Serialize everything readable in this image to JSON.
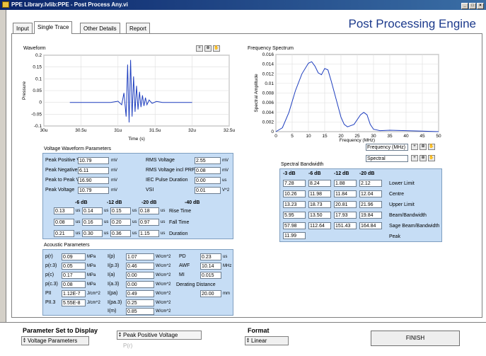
{
  "window": {
    "title": "PPE Library.lvlib:PPE - Post Process Any.vi"
  },
  "app_title": "Post Processing Engine",
  "tabs": [
    "Input",
    "Single Trace",
    "Other Details",
    "Report"
  ],
  "waveform": {
    "title": "Waveform",
    "ylabel": "Pressure",
    "xlabel": "Time (s)",
    "x_ticks": [
      "30u",
      "30.5u",
      "31u",
      "31.5u",
      "32u",
      "32.5u"
    ],
    "y_ticks": [
      "0.2",
      "0.15",
      "0.1",
      "0.05",
      "0",
      "-0.05",
      "-0.1"
    ]
  },
  "spectrum": {
    "title": "Frequency Spectrum",
    "ylabel": "Spectral Amplitude",
    "xlabel": "Frequency (MHz)",
    "x_ticks": [
      "0",
      "5",
      "10",
      "15",
      "20",
      "25",
      "30",
      "35",
      "40",
      "45",
      "50"
    ],
    "y_ticks": [
      "0.016",
      "0.014",
      "0.012",
      "0.01",
      "0.008",
      "0.006",
      "0.004",
      "0.002",
      "0"
    ],
    "freq_unit": "Frequency (MHz)",
    "spectral_select": "Spectral"
  },
  "chart_data": [
    {
      "type": "line",
      "title": "Waveform",
      "xlabel": "Time (s)",
      "ylabel": "Pressure",
      "xlim": [
        30,
        32.5
      ],
      "ylim": [
        -0.1,
        0.2
      ],
      "x": [
        30.35,
        30.7,
        30.9,
        31.0,
        31.05,
        31.08,
        31.11,
        31.13,
        31.15,
        31.17,
        31.19,
        31.21,
        31.23,
        31.25,
        31.27,
        31.29,
        31.31,
        31.33,
        31.35,
        31.37,
        31.39,
        31.42,
        31.46,
        31.52,
        31.6,
        31.7,
        32.0
      ],
      "y": [
        0,
        0,
        0,
        0.005,
        -0.01,
        0.04,
        -0.06,
        0.16,
        -0.085,
        0.18,
        -0.06,
        0.11,
        -0.04,
        0.07,
        -0.03,
        0.045,
        -0.02,
        0.03,
        -0.015,
        0.02,
        -0.01,
        0.01,
        -0.004,
        0.004,
        0,
        0,
        0
      ]
    },
    {
      "type": "line",
      "title": "Frequency Spectrum",
      "xlabel": "Frequency (MHz)",
      "ylabel": "Spectral Amplitude",
      "xlim": [
        0,
        50
      ],
      "ylim": [
        0,
        0.016
      ],
      "x": [
        0,
        2,
        4,
        6,
        8,
        10,
        11,
        12,
        13,
        14,
        15,
        16,
        17,
        18,
        19,
        20,
        21,
        22,
        24,
        26,
        27,
        28,
        29,
        30,
        32,
        35,
        40,
        45,
        50
      ],
      "y": [
        0.0,
        0.0008,
        0.004,
        0.0085,
        0.012,
        0.0142,
        0.0145,
        0.0136,
        0.0122,
        0.0118,
        0.0131,
        0.0128,
        0.0105,
        0.008,
        0.0055,
        0.003,
        0.0015,
        0.001,
        0.0015,
        0.0035,
        0.004,
        0.0035,
        0.0015,
        0.0005,
        0.0002,
        0.0003,
        0.0002,
        0.0001,
        0.0
      ]
    }
  ],
  "voltage": {
    "title": "Voltage Waveform Parameters",
    "rows": [
      {
        "label": "Peak Positive Voltage",
        "value": "10.79",
        "unit": "mV",
        "label2": "RMS Voltage",
        "value2": "2.55",
        "unit2": "mV"
      },
      {
        "label": "Peak Negative Voltage",
        "value": "6.11",
        "unit": "mV",
        "label2": "RMS Voltage incl PRF",
        "value2": "0.08",
        "unit2": "mV"
      },
      {
        "label": "Peak to Peak Voltage",
        "value": "16.90",
        "unit": "mV",
        "label2": "IEC Pulse Duration",
        "value2": "0.00",
        "unit2": "us"
      },
      {
        "label": "Peak Voltage",
        "value": "10.79",
        "unit": "mV",
        "label2": "VSI",
        "value2": "0.01",
        "unit2": "V^2"
      }
    ],
    "db_headers": [
      "-6 dB",
      "-12 dB",
      "-20 dB",
      "-40 dB"
    ],
    "time_rows": [
      {
        "values": [
          "0.13",
          "0.14",
          "0.15",
          "0.18"
        ],
        "unit": "us",
        "label": "Rise Time"
      },
      {
        "values": [
          "0.08",
          "0.16",
          "0.20",
          "0.97"
        ],
        "unit": "us",
        "label": "Fall Time"
      },
      {
        "values": [
          "0.21",
          "0.30",
          "0.36",
          "1.15"
        ],
        "unit": "us",
        "label": "Duration"
      }
    ]
  },
  "acoustic": {
    "title": "Acoustic Parameters",
    "col1": [
      {
        "label": "p(r)",
        "value": "0.09",
        "unit": "MPa"
      },
      {
        "label": "p(r.3)",
        "value": "0.05",
        "unit": "MPa"
      },
      {
        "label": "p(c)",
        "value": "0.17",
        "unit": "MPa"
      },
      {
        "label": "p(c.3)",
        "value": "0.08",
        "unit": "MPa"
      },
      {
        "label": "PII",
        "value": "1.12E-7",
        "unit": "J/cm^2"
      },
      {
        "label": "PII.3",
        "value": "5.55E-8",
        "unit": "J/cm^2"
      }
    ],
    "col2": [
      {
        "label": "I(p)",
        "value": "1.07",
        "unit": "W/cm^2"
      },
      {
        "label": "I(p.3)",
        "value": "0.46",
        "unit": "W/cm^2"
      },
      {
        "label": "I(a)",
        "value": "0.00",
        "unit": "W/cm^2"
      },
      {
        "label": "I(a.3)",
        "value": "0.00",
        "unit": "W/cm^2"
      },
      {
        "label": "I(pa)",
        "value": "0.49",
        "unit": "W/cm^2"
      },
      {
        "label": "I(pa.3)",
        "value": "0.25",
        "unit": "W/cm^2"
      },
      {
        "label": "I(m)",
        "value": "0.85",
        "unit": "W/cm^2"
      }
    ],
    "col3": [
      {
        "label": "PD",
        "value": "0.23",
        "unit": "us"
      },
      {
        "label": "AWF",
        "value": "10.14",
        "unit": "MHz"
      },
      {
        "label": "MI",
        "value": "0.015",
        "unit": ""
      }
    ],
    "derating_label": "Derating Distance",
    "derating_value": "20.00",
    "derating_unit": "mm"
  },
  "bandwidth": {
    "title": "Spectral Bandwidth",
    "headers": [
      "-3 dB",
      "-6 dB",
      "-12 dB",
      "-20 dB"
    ],
    "rows": [
      {
        "values": [
          "7.28",
          "8.24",
          "1.88",
          "2.12"
        ],
        "label": "Lower Limit"
      },
      {
        "values": [
          "10.26",
          "11.98",
          "11.84",
          "12.04"
        ],
        "label": "Centre"
      },
      {
        "values": [
          "13.23",
          "18.73",
          "20.81",
          "21.96"
        ],
        "label": "Upper Limit"
      },
      {
        "values": [
          "5.95",
          "13.50",
          "17.93",
          "19.84"
        ],
        "label": "Beam/Bandwidth"
      },
      {
        "values": [
          "57.98",
          "112.64",
          "151.43",
          "164.84"
        ],
        "label": "Sage Beam/Bandwidth"
      }
    ],
    "peak_value": "11.99",
    "peak_label": "Peak"
  },
  "bottom": {
    "param_label": "Parameter Set to Display",
    "param_value": "Voltage Parameters",
    "sub_value": "Peak Positive Voltage",
    "sub_value2": "P(r)",
    "format_label": "Format",
    "format_value": "Linear",
    "finish_label": "FINISH"
  }
}
